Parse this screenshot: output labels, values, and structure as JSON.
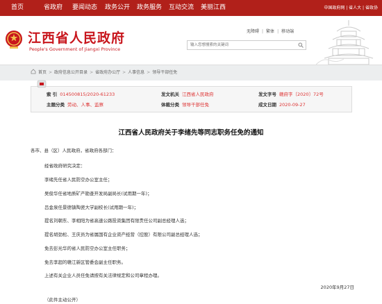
{
  "topnav": {
    "items": [
      "首页",
      "省政府",
      "要闻动态",
      "政务公开",
      "政务服务",
      "互动交流",
      "美丽江西"
    ],
    "utility": "中国政府网 | 省人大 | 省政协"
  },
  "header": {
    "title": "江西省人民政府",
    "subtitle": "People's Government of Jiangxi Province",
    "links": [
      "无障碍",
      "繁体",
      "移动端"
    ],
    "search_placeholder": "输入您想搜索的关键词"
  },
  "breadcrumb": [
    "首页",
    "政府信息公开目录",
    "省政府办公厅",
    "人事信息",
    "领导干部任免"
  ],
  "info": {
    "suoyin_label": "索 引",
    "suoyin_value": "014500815/2020-61233",
    "fawen_label": "发文机关",
    "fawen_value": "江西省人民政府",
    "wenhao_label": "发文字号",
    "wenhao_value": "赣府字〔2020〕72号",
    "zhuti_label": "主题分类",
    "zhuti_value": "劳动、人事、监察",
    "ticai_label": "体裁分类",
    "ticai_value": "领导干部任免",
    "riqi_label": "成文日期",
    "riqi_value": "2020-09-27"
  },
  "article": {
    "title": "江西省人民政府关于李绪先等同志职务任免的通知",
    "salutation": "各市、县（区）人民政府，省政府各部门：",
    "paragraphs": [
      "经省政府研究决定：",
      "李绪先任省人民防空办公室主任；",
      "吴俊华任省地质矿产勘查开发局副局长(试用期一年)；",
      "吕金泉任景德镇陶瓷大学副校长(试用期一年)；",
      "提名刘朝东、李相阳为省高速公路投资集团有限责任公司副总经理人选；",
      "提名胡劲松、王庆员为省属国有企业资产经营（控股）有限公司副总经理人选；",
      "免去彭光华的省人民防空办公室主任职务；",
      "免去李超的赣江新区管委会副主任职务。",
      "上述有关企业人员任免请按有关法律规定和公司章程办理。"
    ],
    "date": "2020年9月27日",
    "footnote": "（此件主动公开）"
  }
}
